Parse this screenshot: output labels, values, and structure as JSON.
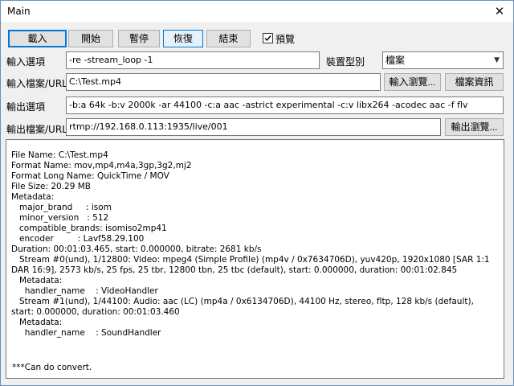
{
  "window": {
    "title": "Main",
    "close_glyph": "✕"
  },
  "toolbar": {
    "load": "載入",
    "start": "開始",
    "pause": "暫停",
    "resume": "恢復",
    "stop": "結束",
    "preview_label": "預覽",
    "preview_checked": true
  },
  "input_options": {
    "label": "輸入選項",
    "value": "-re -stream_loop -1"
  },
  "device_type": {
    "label": "裝置型別",
    "selected": "檔案"
  },
  "input_file": {
    "label": "輸入檔案/URL",
    "value": "C:\\Test.mp4",
    "browse": "輸入瀏覽...",
    "info": "檔案資訊"
  },
  "output_options": {
    "label": "輸出選項",
    "value": "-b:a 64k -b:v 2000k -ar 44100 -c:a aac -astrict experimental -c:v libx264 -acodec aac -f flv"
  },
  "output_file": {
    "label": "輸出檔案/URL",
    "value": "rtmp://192.168.0.113:1935/live/001",
    "browse": "輸出瀏覽..."
  },
  "log": {
    "text": "File Name: C:\\Test.mp4\nFormat Name: mov,mp4,m4a,3gp,3g2,mj2\nFormat Long Name: QuickTime / MOV\nFile Size: 20.29 MB\nMetadata:\n   major_brand     : isom\n   minor_version   : 512\n   compatible_brands: isomiso2mp41\n   encoder         : Lavf58.29.100\nDuration: 00:01:03.465, start: 0.000000, bitrate: 2681 kb/s\n   Stream #0(und), 1/12800: Video: mpeg4 (Simple Profile) (mp4v / 0x7634706D), yuv420p, 1920x1080 [SAR 1:1 DAR 16:9], 2573 kb/s, 25 fps, 25 tbr, 12800 tbn, 25 tbc (default), start: 0.000000, duration: 00:01:02.845\n   Metadata:\n     handler_name    : VideoHandler\n   Stream #1(und), 1/44100: Audio: aac (LC) (mp4a / 0x6134706D), 44100 Hz, stereo, fltp, 128 kb/s (default), start: 0.000000, duration: 00:01:03.460\n   Metadata:\n     handler_name    : SoundHandler",
    "status": "***Can do convert."
  }
}
